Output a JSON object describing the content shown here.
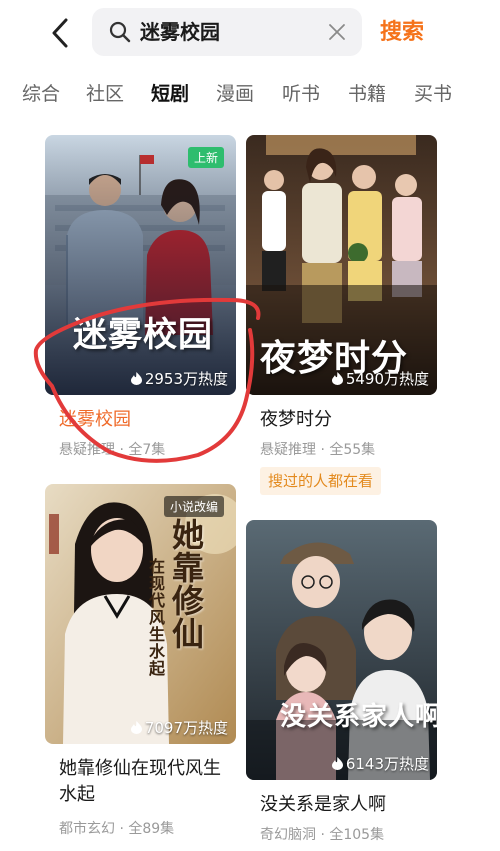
{
  "header": {
    "back_icon": "chevron-left-icon",
    "search_icon": "search-icon",
    "query": "迷雾校园",
    "clear_icon": "close-icon",
    "search_label": "搜索"
  },
  "tabs": [
    {
      "label": "综合"
    },
    {
      "label": "社区"
    },
    {
      "label": "短剧",
      "active": true
    },
    {
      "label": "漫画"
    },
    {
      "label": "听书"
    },
    {
      "label": "书籍"
    },
    {
      "label": "买书"
    }
  ],
  "cards": [
    {
      "poster_title": "迷雾校园",
      "badge": "上新",
      "heat": "2953万热度",
      "title": "迷雾校园",
      "meta": "悬疑推理 · 全7集"
    },
    {
      "poster_title": "夜梦时分",
      "heat": "5490万热度",
      "title": "夜梦时分",
      "meta": "悬疑推理 · 全55集",
      "tag": "搜过的人都在看"
    },
    {
      "poster_title": "她靠修仙",
      "poster_subtitle": "在现代风生水起",
      "badge": "小说改编",
      "heat": "7097万热度",
      "title": "她靠修仙在现代风生水起",
      "meta": "都市玄幻 · 全89集"
    },
    {
      "poster_title": "没关系家人啊",
      "heat": "6143万热度",
      "title": "没关系是家人啊",
      "meta": "奇幻脑洞 · 全105集"
    }
  ],
  "colors": {
    "accent": "#f5731b",
    "active_title": "#ef6a2a",
    "badge_new": "#2ebd6e",
    "annotation": "#e23a3a"
  }
}
